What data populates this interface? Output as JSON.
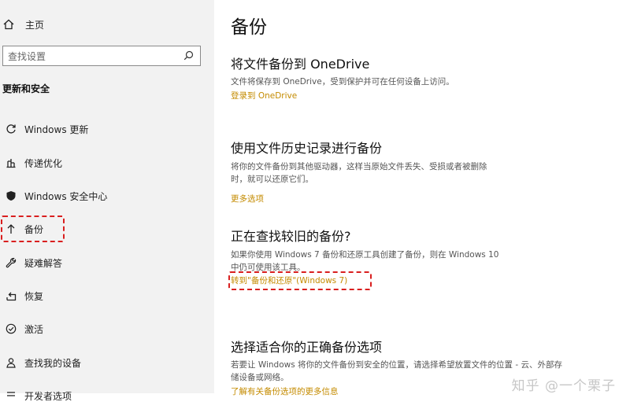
{
  "sidebar": {
    "home_label": "主页",
    "search_placeholder": "查找设置",
    "section_title": "更新和安全",
    "items": [
      {
        "label": "Windows 更新",
        "icon": "refresh-icon"
      },
      {
        "label": "传递优化",
        "icon": "delivery-icon"
      },
      {
        "label": "Windows 安全中心",
        "icon": "shield-icon"
      },
      {
        "label": "备份",
        "icon": "arrow-up-icon",
        "active": true
      },
      {
        "label": "疑难解答",
        "icon": "wrench-icon"
      },
      {
        "label": "恢复",
        "icon": "recovery-icon"
      },
      {
        "label": "激活",
        "icon": "check-circle-icon"
      },
      {
        "label": "查找我的设备",
        "icon": "person-pin-icon"
      },
      {
        "label": "开发者选项",
        "icon": "developer-icon"
      }
    ]
  },
  "main": {
    "title": "备份",
    "onedrive": {
      "heading": "将文件备份到 OneDrive",
      "desc": "文件将保存到 OneDrive，受到保护并可在任何设备上访问。",
      "link": "登录到 OneDrive"
    },
    "file_history": {
      "heading": "使用文件历史记录进行备份",
      "desc_line1": "将你的文件备份到其他驱动器，这样当原始文件丢失、受损或者被删除",
      "desc_line2": "时，就可以还原它们。",
      "link": "更多选项"
    },
    "older_backup": {
      "heading": "正在查找较旧的备份?",
      "desc_line1": "如果你使用 Windows 7 备份和还原工具创建了备份，则在 Windows 10",
      "desc_line2": "中仍可使用该工具。",
      "link": "转到\"备份和还原\"(Windows 7)"
    },
    "choose": {
      "heading": "选择适合你的正确备份选项",
      "desc_line1": "若要让 Windows 将你的文件备份到安全的位置，请选择希望放置文件的位置 - 云、外部存",
      "desc_line2": "储设备或网络。",
      "link": "了解有关备份选项的更多信息"
    }
  },
  "watermark": "知乎 @一个栗子",
  "colors": {
    "sidebar_bg": "#f2f2f2",
    "link": "#c48b00",
    "highlight": "#d91f1f"
  }
}
